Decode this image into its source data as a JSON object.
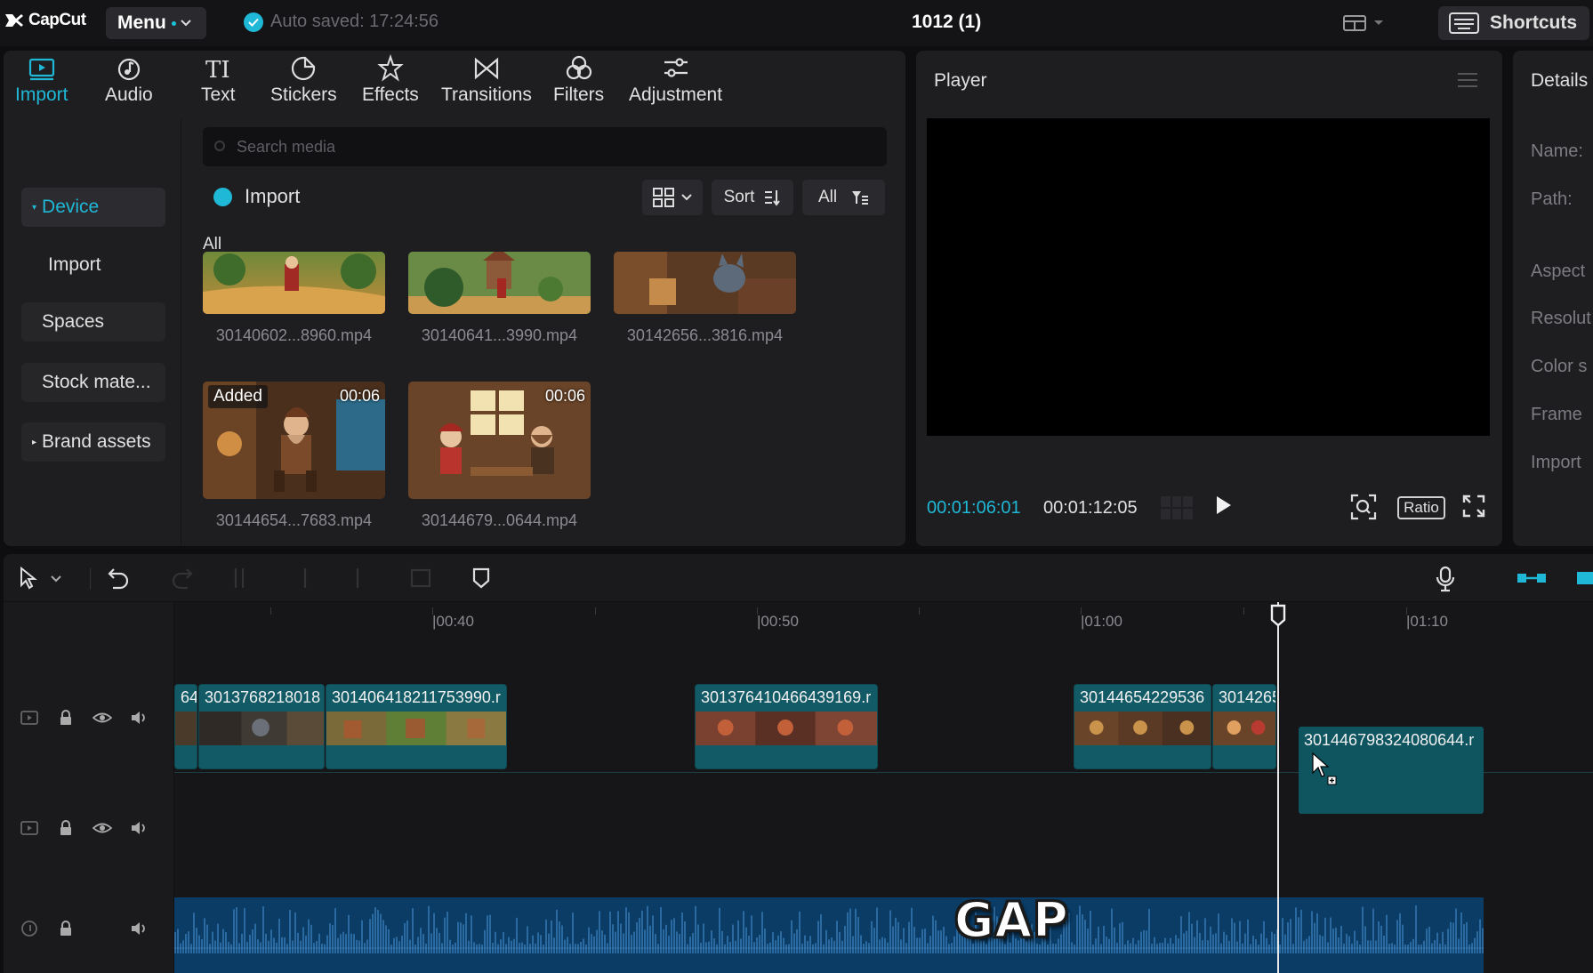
{
  "topbar": {
    "app_name": "CapCut",
    "menu_label": "Menu",
    "autosave_text": "Auto saved: 17:24:56",
    "project_title": "1012 (1)",
    "shortcuts_label": "Shortcuts"
  },
  "tool_tabs": [
    {
      "label": "Import",
      "icon": "import-icon",
      "active": true
    },
    {
      "label": "Audio",
      "icon": "audio-icon"
    },
    {
      "label": "Text",
      "icon": "text-icon"
    },
    {
      "label": "Stickers",
      "icon": "stickers-icon"
    },
    {
      "label": "Effects",
      "icon": "effects-icon"
    },
    {
      "label": "Transitions",
      "icon": "transitions-icon"
    },
    {
      "label": "Filters",
      "icon": "filters-icon"
    },
    {
      "label": "Adjustment",
      "icon": "adjustment-icon"
    }
  ],
  "side_nav": {
    "device": "Device",
    "import": "Import",
    "spaces": "Spaces",
    "stock": "Stock mate...",
    "brand": "Brand assets"
  },
  "media": {
    "search_placeholder": "Search media",
    "import_label": "Import",
    "sort_label": "Sort",
    "filter_label": "All",
    "section_label": "All",
    "items": [
      {
        "name": "30140602...8960.mp4"
      },
      {
        "name": "30140641...3990.mp4"
      },
      {
        "name": "30142656...3816.mp4"
      },
      {
        "name": "30144654...7683.mp4",
        "badge": "Added",
        "duration": "00:06"
      },
      {
        "name": "30144679...0644.mp4",
        "duration": "00:06"
      }
    ]
  },
  "player": {
    "title": "Player",
    "current_time": "00:01:06:01",
    "total_time": "00:01:12:05",
    "ratio_label": "Ratio"
  },
  "details": {
    "title": "Details",
    "labels": [
      "Name:",
      "Path:",
      "Aspect",
      "Resolut",
      "Color s",
      "Frame",
      "Import"
    ]
  },
  "timeline": {
    "ruler": [
      "00:40",
      "00:50",
      "01:00",
      "01:10"
    ],
    "clips": [
      {
        "label": "64"
      },
      {
        "label": "3013768218018"
      },
      {
        "label": "3014064182117539 90.r"
      },
      {
        "label": "301376410466439169.r"
      },
      {
        "label": "30144654229536"
      },
      {
        "label": "3014265"
      }
    ],
    "floating_clip": "301446798324080644.r",
    "gap_label": "GAP"
  },
  "colors": {
    "accent": "#1fb8d6",
    "clip": "#125b66",
    "audio": "#0a3c66",
    "panel": "#1e1e21"
  }
}
